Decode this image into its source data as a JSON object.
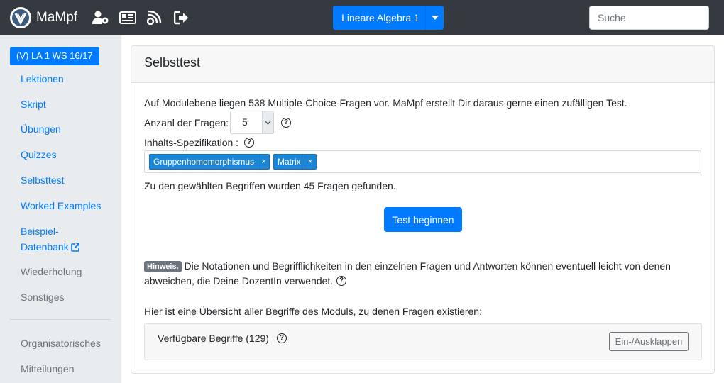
{
  "brand": {
    "name": "MaMpf"
  },
  "nav": {
    "icons": [
      "user-cog-icon",
      "newspaper-icon",
      "feed-icon",
      "sign-out-icon"
    ],
    "course_selector": "Lineare Algebra 1",
    "search": {
      "placeholder": "Suche",
      "value": ""
    }
  },
  "sidebar": {
    "course_badge": "(V) LA 1 WS 16/17",
    "items": [
      {
        "label": "Lektionen"
      },
      {
        "label": "Skript"
      },
      {
        "label": "Übungen"
      },
      {
        "label": "Quizzes"
      },
      {
        "label": "Selbsttest"
      },
      {
        "label": "Worked Examples"
      },
      {
        "label": "Beispiel-"
      },
      {
        "label": "Datenbank"
      },
      {
        "label": "Wiederholung"
      },
      {
        "label": "Sonstiges"
      }
    ],
    "extra_items": [
      {
        "label": "Organisatorisches"
      },
      {
        "label": "Mitteilungen"
      }
    ]
  },
  "main": {
    "title": "Selbsttest",
    "intro": "Auf Modulebene liegen 538 Multiple-Choice-Fragen vor. MaMpf erstellt Dir daraus gerne einen zufälligen Test.",
    "count_label": "Anzahl der Fragen:",
    "count_value": "5",
    "spec_label": "Inhalts-Spezifikation :",
    "tags": [
      "Gruppenhomomorphismus",
      "Matrix"
    ],
    "found_text": "Zu den gewählten Begriffen wurden 45 Fragen gefunden.",
    "start_button": "Test beginnen",
    "hint_badge": "Hinweis.",
    "hint_line1": "Die Notationen und Begrifflichkeiten in den einzelnen Fragen und Antworten können eventuell leicht von denen",
    "hint_line2": "abweichen, die Deine DozentIn verwendet.",
    "overview_text": "Hier ist eine Übersicht aller Begriffe des Moduls, zu denen Fragen existieren:",
    "terms_label": "Verfügbare Begriffe (129)",
    "toggle_button": "Ein-/Ausklappen"
  },
  "colors": {
    "navbar": "#343a40",
    "primary": "#007bff",
    "sidebar": "#e9ecef",
    "tag": "#1b86d6"
  }
}
